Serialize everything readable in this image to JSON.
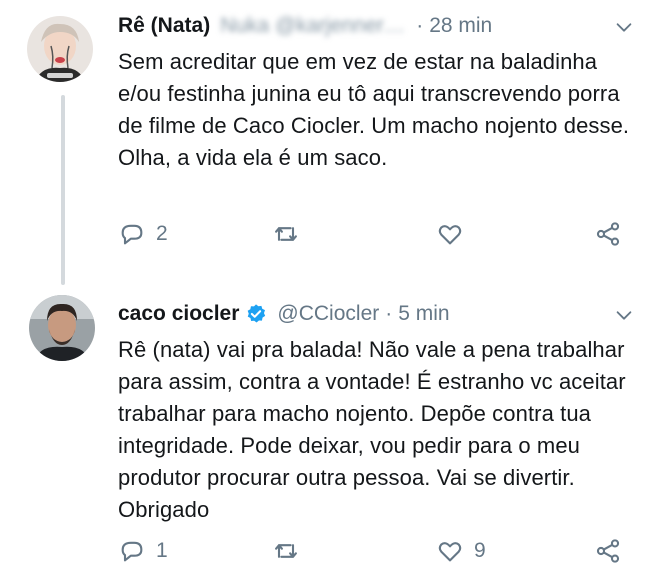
{
  "tweets": [
    {
      "display_name": "Rê (Nata)",
      "handle": "Nuka @karjennerbai...",
      "time": "28 min",
      "text": "Sem acreditar que em vez de estar na baladinha e/ou festinha junina eu tô aqui transcrevendo porra de filme de Caco Ciocler. Um macho nojento desse. Olha, a vida ela é um saco.",
      "reply_count": "2",
      "retweet_count": "",
      "like_count": ""
    },
    {
      "display_name": "caco ciocler",
      "handle": "@CCiocler",
      "time": "5 min",
      "verified": true,
      "text": "Rê (nata) vai pra balada! Não vale a pena trabalhar para assim, contra a vontade! É estranho vc aceitar trabalhar para macho nojento. Depõe contra tua integridade. Pode deixar, vou pedir para o meu produtor procurar outra pessoa. Vai se divertir. Obrigado",
      "reply_count": "1",
      "retweet_count": "",
      "like_count": "9"
    }
  ],
  "colors": {
    "text": "#14171a",
    "muted": "#657786",
    "verified": "#1da1f2",
    "thread_line": "#d4d9dd"
  },
  "icons": [
    "reply-icon",
    "retweet-icon",
    "like-icon",
    "share-icon",
    "chevron-down-icon",
    "verified-badge-icon"
  ]
}
